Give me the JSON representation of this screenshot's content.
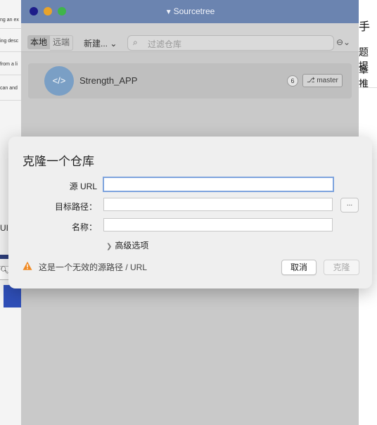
{
  "background": {
    "left_snippets": [
      "ng an ex",
      "ing desc",
      "from a li",
      "can and",
      "UI"
    ],
    "right_chars": [
      "手",
      "题提",
      "章推"
    ]
  },
  "window": {
    "title": "Sourcetree",
    "tabs": [
      {
        "label": "本地"
      },
      {
        "label": "远端"
      }
    ],
    "new_label": "新建...",
    "search_placeholder": "过滤仓库",
    "more_label": "⊖⌄",
    "repo": {
      "name": "Strength_APP",
      "count": "6",
      "branch": "master"
    }
  },
  "dialog": {
    "title": "克隆一个仓库",
    "source_label": "源 URL",
    "source_value": "",
    "dest_label": "目标路径：",
    "dest_value": "",
    "browse_label": "...",
    "name_label": "名称：",
    "name_value": "",
    "advanced_label": "高级选项",
    "warning": "这是一个无效的源路径 / URL",
    "cancel_label": "取消",
    "clone_label": "克隆"
  },
  "colors": {
    "titlebar": "#6b84b0",
    "repo_icon": "#7a9fc5",
    "focus_ring": "#7da3dd",
    "warning": "#f08a24"
  }
}
